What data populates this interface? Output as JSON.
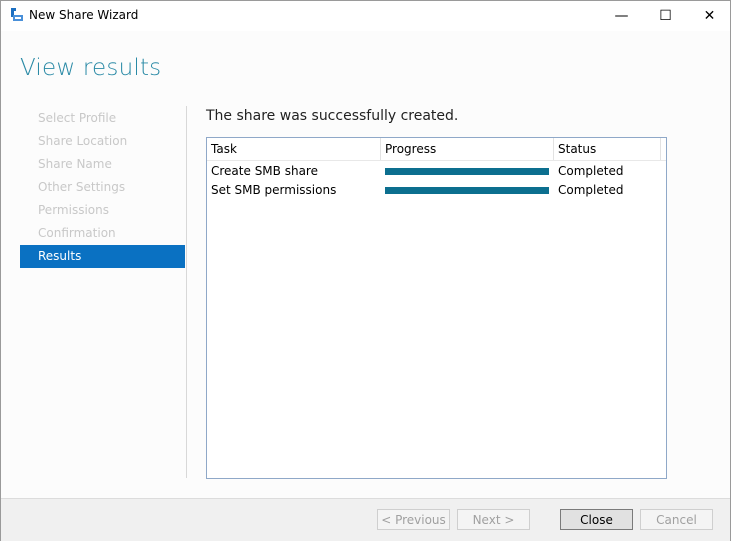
{
  "window": {
    "title": "New Share Wizard",
    "controls": {
      "minimize": "—",
      "maximize": "☐",
      "close": "✕"
    }
  },
  "page": {
    "heading": "View results",
    "message": "The share was successfully created."
  },
  "nav": {
    "items": [
      {
        "label": "Select Profile",
        "active": false
      },
      {
        "label": "Share Location",
        "active": false
      },
      {
        "label": "Share Name",
        "active": false
      },
      {
        "label": "Other Settings",
        "active": false
      },
      {
        "label": "Permissions",
        "active": false
      },
      {
        "label": "Confirmation",
        "active": false
      },
      {
        "label": "Results",
        "active": true
      }
    ]
  },
  "results_table": {
    "columns": [
      "Task",
      "Progress",
      "Status"
    ],
    "rows": [
      {
        "task": "Create SMB share",
        "progress_percent": 100,
        "status": "Completed"
      },
      {
        "task": "Set SMB permissions",
        "progress_percent": 100,
        "status": "Completed"
      }
    ]
  },
  "footer": {
    "previous_label": "< Previous",
    "next_label": "Next >",
    "close_label": "Close",
    "cancel_label": "Cancel"
  },
  "colors": {
    "accent": "#0a71c2",
    "heading": "#2a8aa6",
    "progress": "#0c6f8f"
  }
}
